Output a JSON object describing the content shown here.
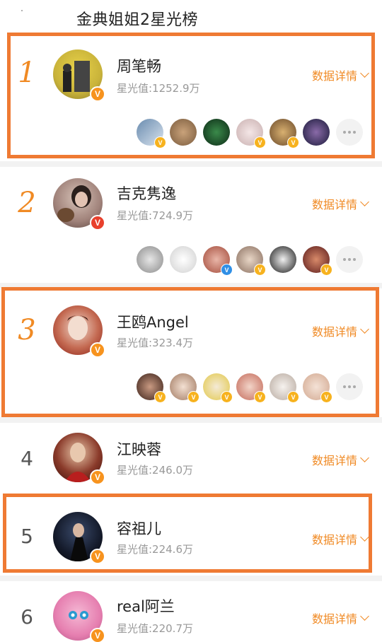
{
  "page": {
    "title": "金典姐姐2星光榜"
  },
  "detail_label": "数据详情",
  "entries": [
    {
      "rank": "1",
      "name": "周笔畅",
      "score": "星光值:1252.9万"
    },
    {
      "rank": "2",
      "name": "吉克隽逸",
      "score": "星光值:724.9万"
    },
    {
      "rank": "3",
      "name": "王鸥Angel",
      "score": "星光值:323.4万"
    },
    {
      "rank": "4",
      "name": "江映蓉",
      "score": "星光值:246.0万"
    },
    {
      "rank": "5",
      "name": "容祖儿",
      "score": "星光值:224.6万"
    },
    {
      "rank": "6",
      "name": "real阿兰",
      "score": "星光值:220.7万"
    }
  ],
  "colors": {
    "accent": "#f08a24",
    "highlight_box": "#ef7a33",
    "verified_badge": "#f7931e"
  },
  "icons": {
    "verified": "verified-v-icon",
    "more": "more-dots-icon",
    "chevron": "chevron-down-icon"
  }
}
